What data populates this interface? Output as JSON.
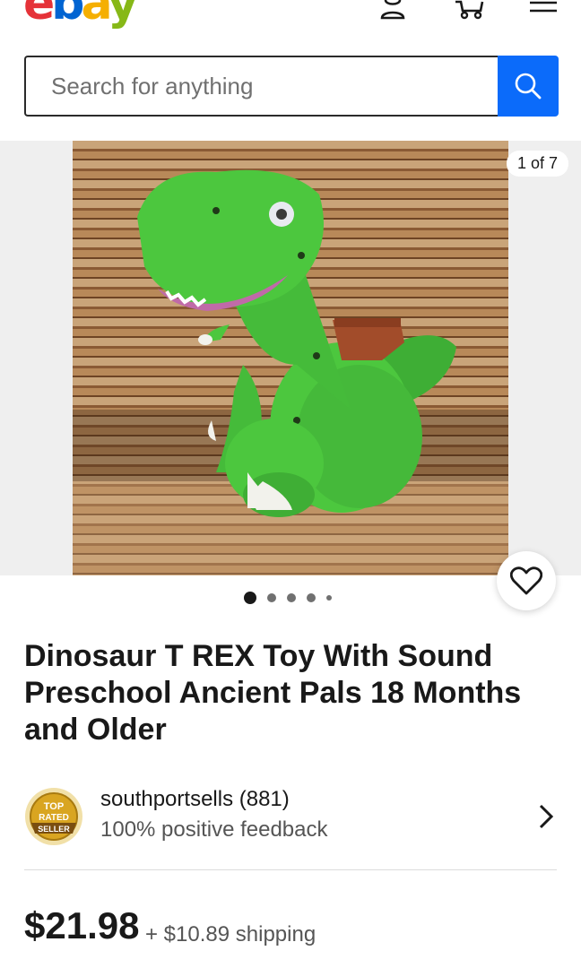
{
  "header": {
    "logo_letters": [
      "e",
      "b",
      "a",
      "y"
    ],
    "icons": [
      "account-icon",
      "cart-icon",
      "menu-icon"
    ]
  },
  "search": {
    "placeholder": "Search for anything",
    "icon": "search-icon"
  },
  "gallery": {
    "counter": "1 of 7",
    "current_index": 1,
    "total": 7,
    "dots_visible": 5
  },
  "listing": {
    "title": "Dinosaur T REX Toy With Sound Preschool Ancient Pals 18 Months and Older"
  },
  "seller": {
    "badge_lines": [
      "TOP",
      "RATED",
      "SELLER"
    ],
    "name": "southportsells (881)",
    "feedback": "100% positive feedback"
  },
  "pricing": {
    "price": "$21.98",
    "shipping": "+ $10.89 shipping"
  },
  "colors": {
    "accent_blue": "#0b6bfa",
    "logo_red": "#e53238",
    "logo_blue": "#0064d2",
    "logo_yellow": "#f5af02",
    "logo_green": "#86b817",
    "toy_green": "#4cc73e",
    "badge_gold": "#d9a521"
  }
}
